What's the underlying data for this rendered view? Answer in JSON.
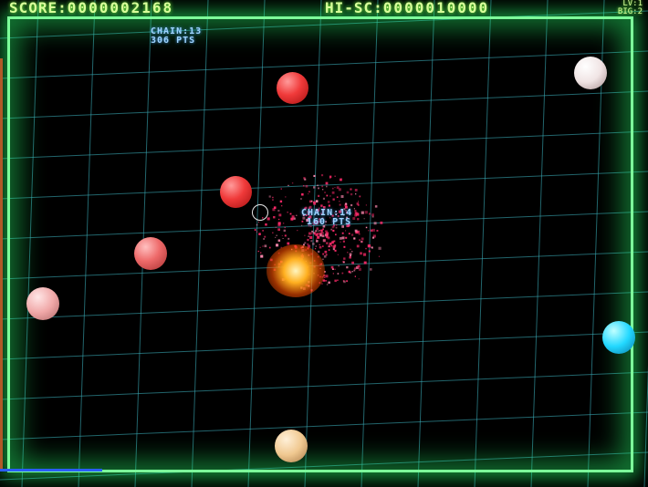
{
  "hud": {
    "score_label": "SCORE:",
    "score_value": "0000002168",
    "hisc_label": "HI-SC:",
    "hisc_value": "0000010000",
    "level": "LV:1",
    "big": "BIG:2"
  },
  "chains": [
    {
      "chain": "CHAIN:13",
      "pts": "306 PTS"
    },
    {
      "chain": "CHAIN:14",
      "pts": "160 PTS"
    }
  ],
  "colors": {
    "frame": "#7dff9a",
    "hud_text": "#d8ff9a",
    "chain_text": "#9fd4ff",
    "grid": "#3aa8b4",
    "ball_red": "#f03a3a",
    "ball_pink": "#f0a8a8",
    "ball_white": "#f0e4e4",
    "ball_cyan": "#22d8ff",
    "ball_peach": "#f0c890",
    "explosion": "#ff2a6a"
  },
  "icons": {
    "reticle": "aim-reticle-icon",
    "explosion": "particle-explosion-icon"
  }
}
